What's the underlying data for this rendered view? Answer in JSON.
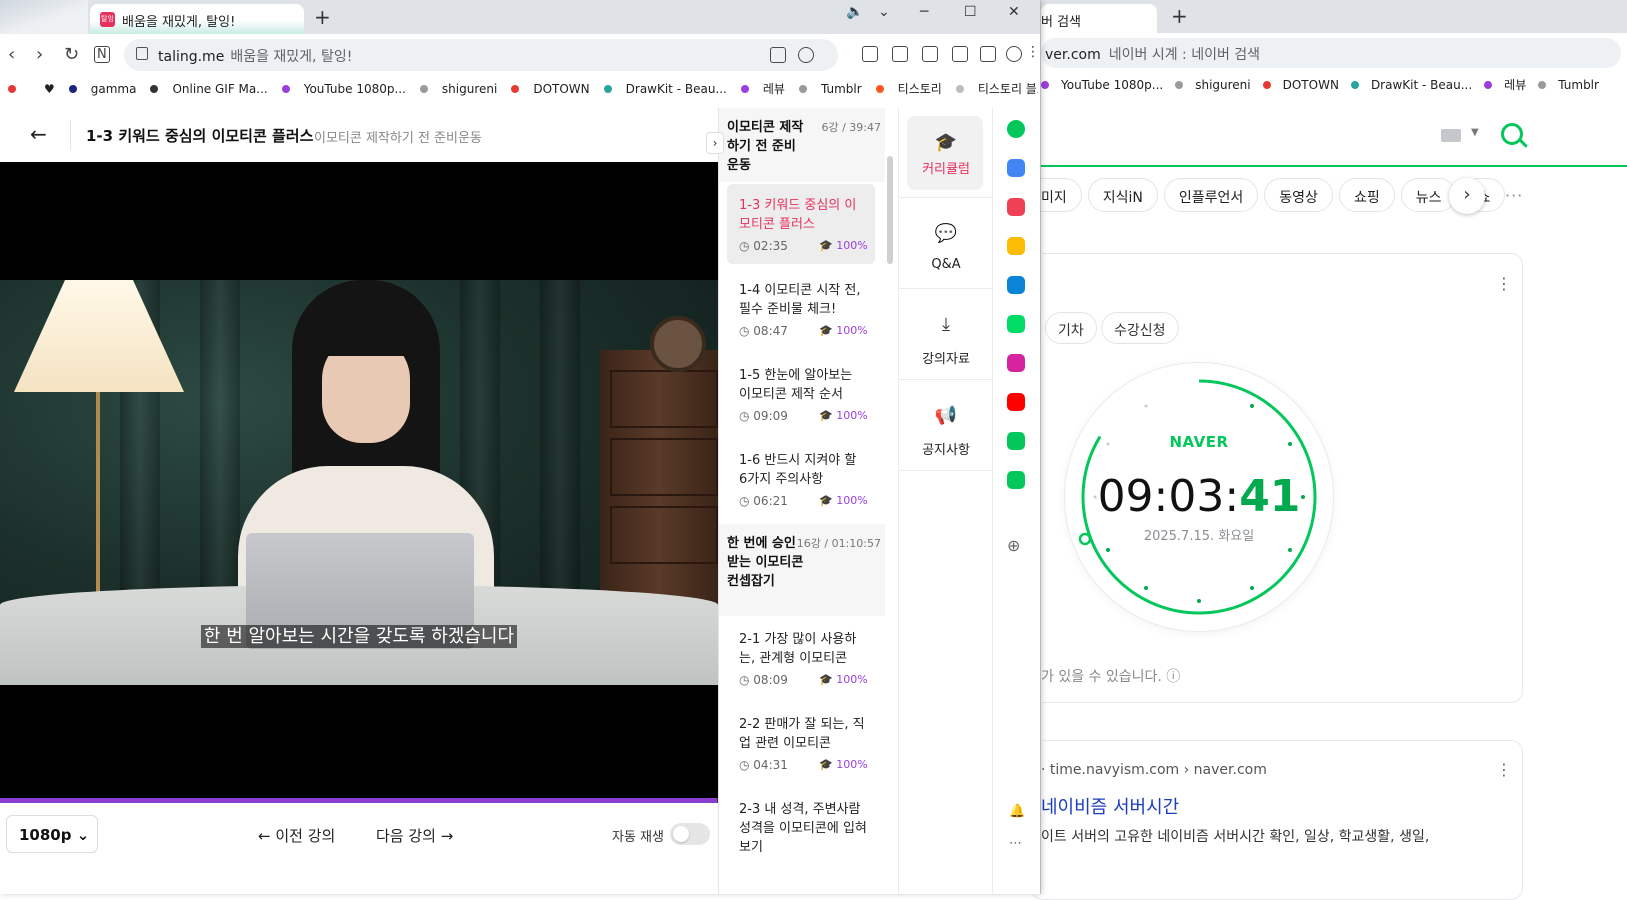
{
  "back_window": {
    "tab_title": "버 검색",
    "newtab": "+",
    "address": "ver.com",
    "address_sub": "네이버 시계 : 네이버 검색",
    "bookmarks": [
      {
        "label": "YouTube 1080p...",
        "color": "#9b3fe0"
      },
      {
        "label": "shigureni",
        "color": "#9a9a9a"
      },
      {
        "label": "DOTOWN",
        "color": "#e53935"
      },
      {
        "label": "DrawKit - Beau...",
        "color": "#26a69a"
      },
      {
        "label": "레뷰",
        "color": "#9b3fe0"
      },
      {
        "label": "Tumblr",
        "color": "#9a9a9a"
      }
    ],
    "chips": [
      "미지",
      "지식iN",
      "인플루언서",
      "동영상",
      "쇼핑",
      "뉴스",
      "쇼"
    ],
    "pills": [
      "기차",
      "수강신청"
    ],
    "clock": {
      "brand": "NAVER",
      "hm": "09:03:",
      "sec": "41",
      "date": "2025.7.15. 화요일"
    },
    "note": "가 있을 수 있습니다. ⓘ",
    "result": {
      "source": "· time.navyism.com › naver.com",
      "title": "네이비즘 서버시간",
      "desc": "이트 서버의 고유한 네이비즘 서버시간 확인, 일상, 학교생활, 생일,"
    }
  },
  "front_window": {
    "tab": {
      "favicon_text": "탈잉",
      "title": "배움을 재밌게, 탈잉!"
    },
    "newtab": "+",
    "controls": {
      "minimize": "─",
      "maximize": "☐",
      "close": "✕"
    },
    "address": {
      "domain": "taling.me",
      "title": "배움을 재밌게, 탈잉!"
    },
    "bookmarks": [
      {
        "label": "",
        "color": "#e53935"
      },
      {
        "label": "♥",
        "color": ""
      },
      {
        "label": "gamma",
        "color": "#1a237e"
      },
      {
        "label": "Online GIF Ma...",
        "color": "#333333"
      },
      {
        "label": "YouTube 1080p...",
        "color": "#9b3fe0"
      },
      {
        "label": "shigureni",
        "color": "#9a9a9a"
      },
      {
        "label": "DOTOWN",
        "color": "#e53935"
      },
      {
        "label": "DrawKit - Beau...",
        "color": "#26a69a"
      },
      {
        "label": "레뷰",
        "color": "#9b3fe0"
      },
      {
        "label": "Tumblr",
        "color": "#9a9a9a"
      },
      {
        "label": "티스토리",
        "color": "#ff5722"
      },
      {
        "label": "티스토리 블로...",
        "color": "#bdbdbd"
      }
    ],
    "page": {
      "back": "←",
      "title": "1-3 키워드 중심의 이모티콘 플러스",
      "subtitle": "이모티콘 제작하기 전 준비운동"
    },
    "video": {
      "caption": "한 번 알아보는 시간을 갖도록 하겠습니다",
      "progress": 0.998
    },
    "controls_bar": {
      "quality": "1080p",
      "prev": "← 이전 강의",
      "next": "다음 강의 →",
      "autoplay_label": "자동 재생",
      "autoplay_on": false
    },
    "curriculum": {
      "sections": [
        {
          "title": "이모티콘 제작하기 전 준비운동",
          "meta": "6강 / 39:47",
          "lessons": [
            {
              "title": "1-3 키워드 중심의 이모티콘 플러스",
              "duration": "02:35",
              "progress": "100%",
              "active": true
            },
            {
              "title": "1-4 이모티콘 시작 전, 필수 준비물 체크!",
              "duration": "08:47",
              "progress": "100%",
              "active": false
            },
            {
              "title": "1-5 한눈에 알아보는 이모티콘 제작 순서",
              "duration": "09:09",
              "progress": "100%",
              "active": false
            },
            {
              "title": "1-6 반드시 지켜야 할 6가지 주의사항",
              "duration": "06:21",
              "progress": "100%",
              "active": false
            }
          ]
        },
        {
          "title": "한 번에 승인받는 이모티콘 컨셉잡기",
          "meta": "16강 / 01:10:57",
          "lessons": [
            {
              "title": "2-1 가장 많이 사용하는, 관계형 이모티콘",
              "duration": "08:09",
              "progress": "100%",
              "active": false
            },
            {
              "title": "2-2 판매가 잘 되는, 직업 관련 이모티콘",
              "duration": "04:31",
              "progress": "100%",
              "active": false
            },
            {
              "title": "2-3 내 성격, 주변사람 성격을 이모티콘에 입혀보기",
              "duration": "",
              "progress": "",
              "active": false
            }
          ]
        }
      ]
    },
    "side_tabs": [
      {
        "label": "커리큘럼",
        "icon": "graduation-cap-icon",
        "glyph": "🎓",
        "active": true
      },
      {
        "label": "Q&A",
        "icon": "chat-icon",
        "glyph": "💬",
        "active": false
      },
      {
        "label": "강의자료",
        "icon": "download-icon",
        "glyph": "⤓",
        "active": false
      },
      {
        "label": "공지사항",
        "icon": "megaphone-icon",
        "glyph": "📢",
        "active": false
      }
    ],
    "extensions": [
      {
        "name": "extension-circle-icon",
        "color": "#03c75a"
      },
      {
        "name": "extension-calendar-icon",
        "color": "#4285f4"
      },
      {
        "name": "extension-pocket-icon",
        "color": "#ef4056"
      },
      {
        "name": "extension-star-icon",
        "color": "#fbbc04"
      },
      {
        "name": "extension-edge-icon",
        "color": "#0a84d6"
      },
      {
        "name": "extension-webtoon-icon",
        "color": "#00dc64"
      },
      {
        "name": "extension-instagram-icon",
        "color": "#d6249f"
      },
      {
        "name": "extension-youtube-icon",
        "color": "#ff0000"
      },
      {
        "name": "extension-stock-icon",
        "color": "#03c75a"
      },
      {
        "name": "extension-naver-icon",
        "color": "#03c75a"
      }
    ]
  }
}
